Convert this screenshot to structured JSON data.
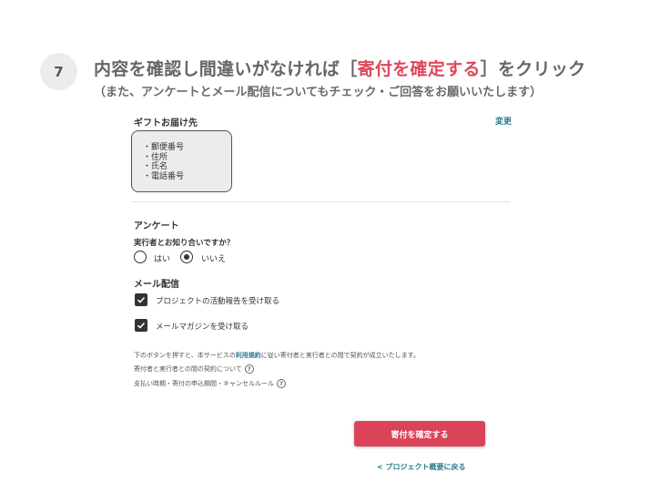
{
  "step": {
    "number": "7",
    "title_prefix": "内容を確認し間違いがなければ",
    "bracket_open": "［",
    "title_highlight": "寄付を確定する",
    "bracket_close": "］",
    "title_suffix": "をクリック",
    "subtitle": "（また、アンケートとメール配信についてもチェック・ご回答をお願いいたします）"
  },
  "gift": {
    "heading": "ギフトお届け先",
    "change_label": "変更",
    "address_fields": [
      "郵便番号",
      "住所",
      "氏名",
      "電話番号"
    ]
  },
  "survey": {
    "heading": "アンケート",
    "question": "実行者とお知り合いですか？",
    "options": [
      {
        "label": "はい",
        "selected": false
      },
      {
        "label": "いいえ",
        "selected": true
      }
    ]
  },
  "mail": {
    "heading": "メール配信",
    "options": [
      {
        "label": "プロジェクトの活動報告を受け取る",
        "checked": true
      },
      {
        "label": "メールマガジンを受け取る",
        "checked": true
      }
    ]
  },
  "notices": {
    "line1_before": "下のボタンを押すと、本サービスの",
    "line1_link": "利用規約",
    "line1_after": "に従い寄付者と実行者との間で契約が成立いたします。",
    "line2": "寄付者と実行者との間の契約について",
    "line3": "支払い時期・寄付の申込期間・キャンセルルール",
    "help_glyph": "?"
  },
  "actions": {
    "confirm_label": "寄付を確定する",
    "back_label": "< プロジェクト概要に戻る"
  },
  "colors": {
    "accent": "#db4458",
    "link": "#2d7a8c",
    "highlight_text": "#e0475a"
  }
}
